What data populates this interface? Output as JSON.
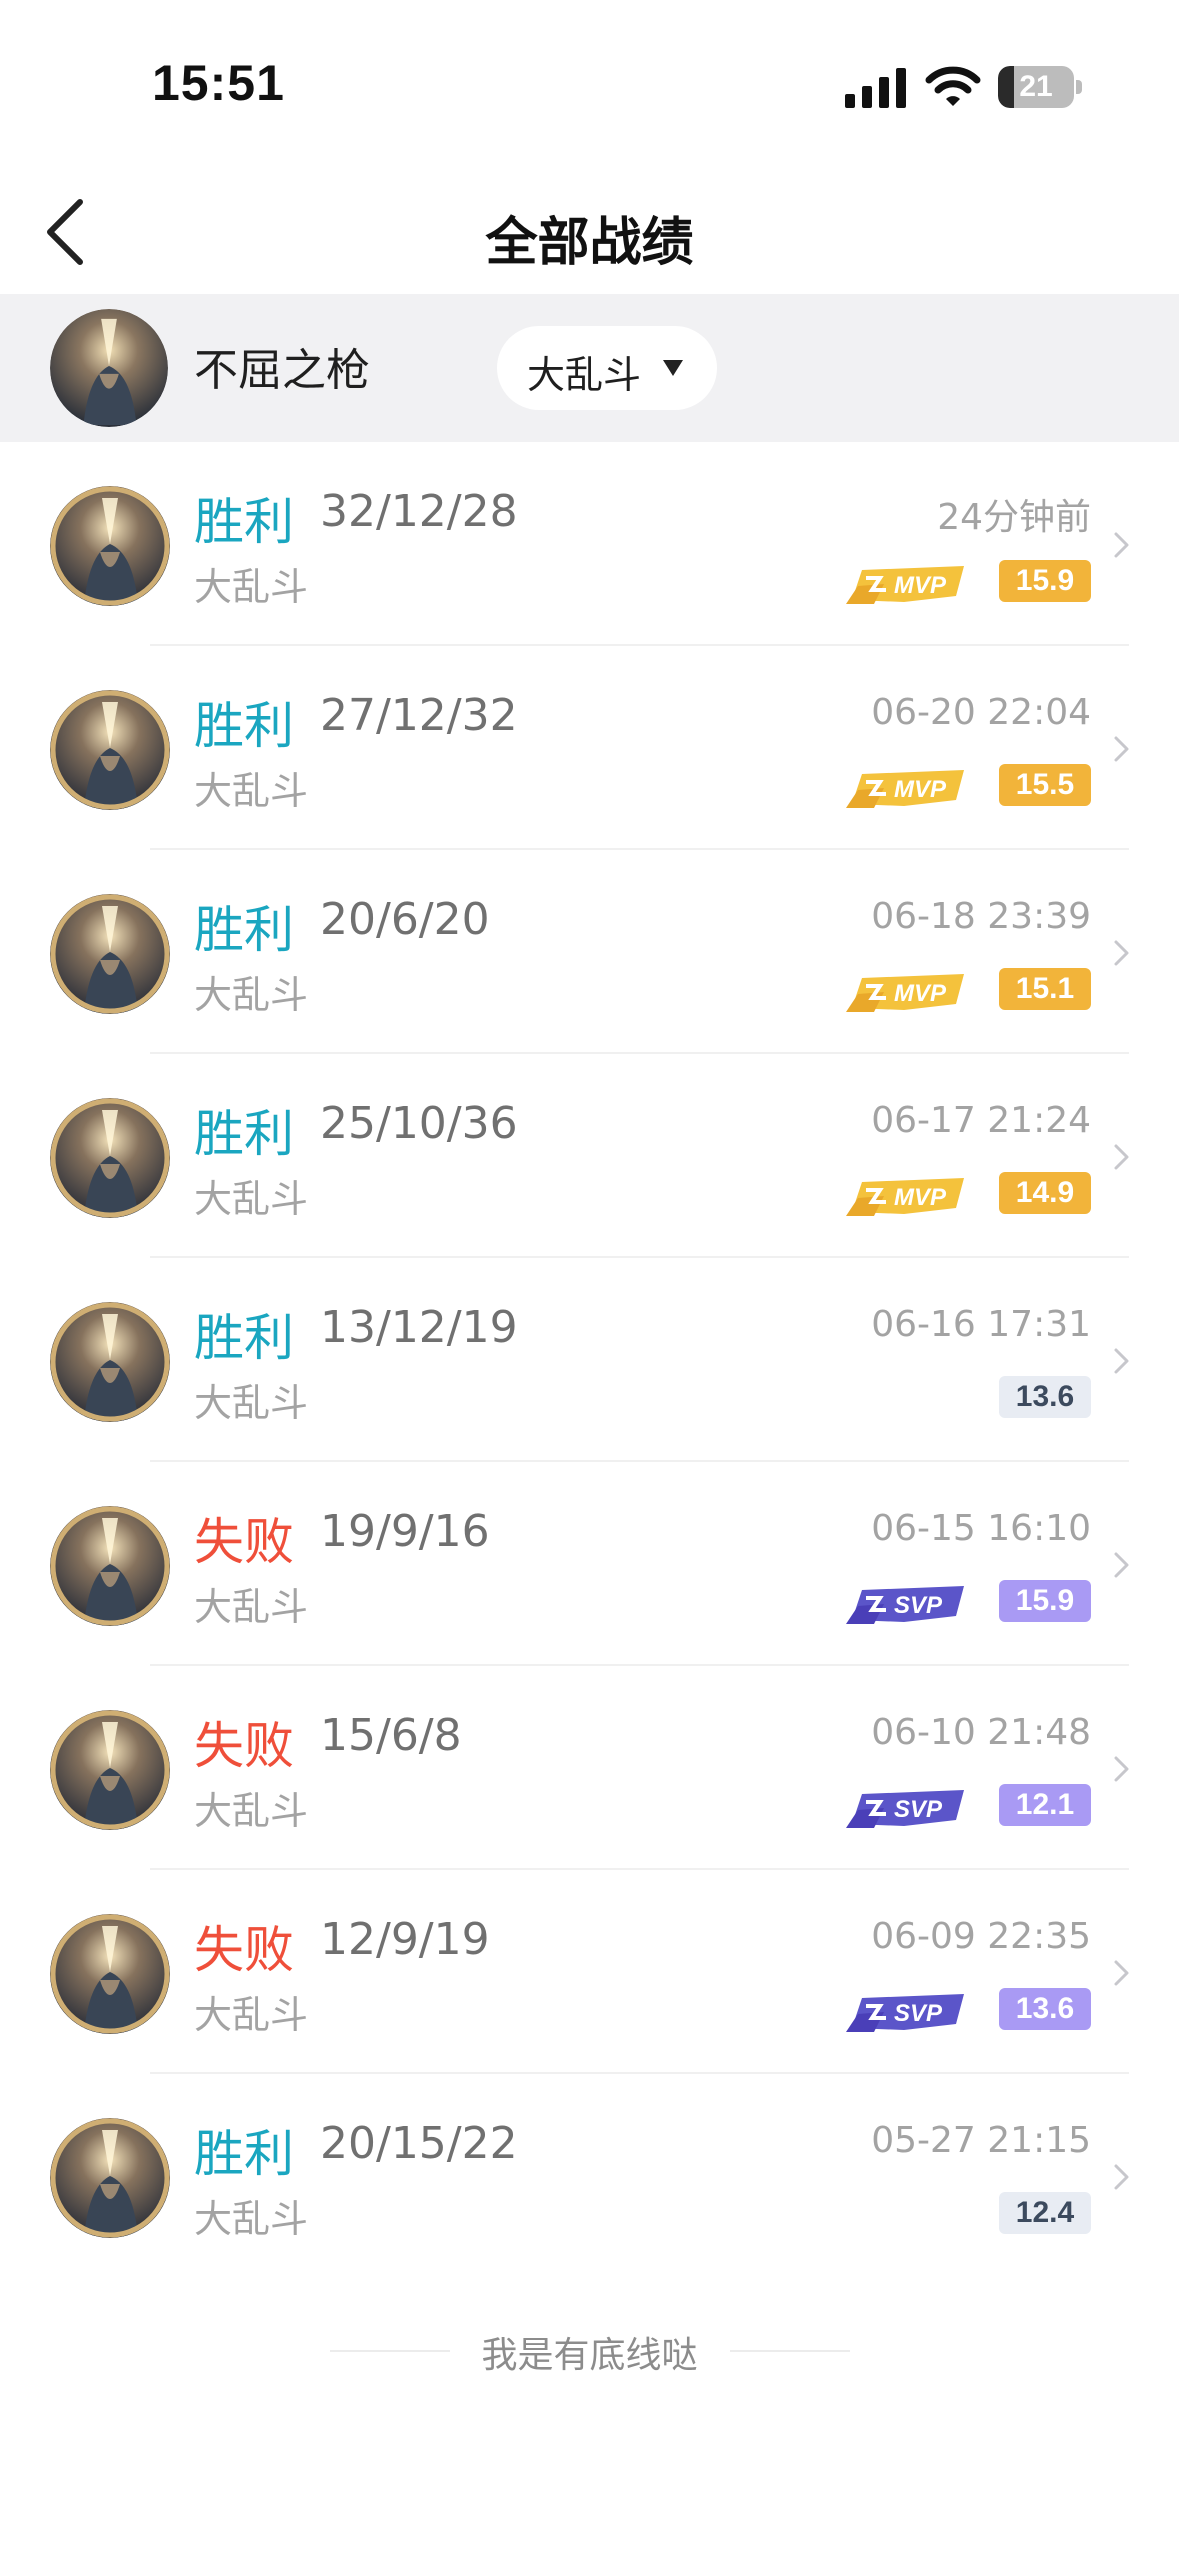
{
  "status_bar": {
    "time": "15:51",
    "battery_level": "21",
    "battery_fraction": 0.21
  },
  "nav": {
    "title": "全部战绩",
    "back_icon": "chevron-left-icon"
  },
  "filter": {
    "player_name": "不屈之枪",
    "mode_selected": "大乱斗"
  },
  "matches": [
    {
      "result": "胜利",
      "outcome": "win",
      "kda": "32/12/28",
      "mode": "大乱斗",
      "time": "24分钟前",
      "badge": "MVP",
      "score": "15.9"
    },
    {
      "result": "胜利",
      "outcome": "win",
      "kda": "27/12/32",
      "mode": "大乱斗",
      "time": "06-20 22:04",
      "badge": "MVP",
      "score": "15.5"
    },
    {
      "result": "胜利",
      "outcome": "win",
      "kda": "20/6/20",
      "mode": "大乱斗",
      "time": "06-18 23:39",
      "badge": "MVP",
      "score": "15.1"
    },
    {
      "result": "胜利",
      "outcome": "win",
      "kda": "25/10/36",
      "mode": "大乱斗",
      "time": "06-17 21:24",
      "badge": "MVP",
      "score": "14.9"
    },
    {
      "result": "胜利",
      "outcome": "win",
      "kda": "13/12/19",
      "mode": "大乱斗",
      "time": "06-16 17:31",
      "badge": "",
      "score": "13.6"
    },
    {
      "result": "失败",
      "outcome": "lose",
      "kda": "19/9/16",
      "mode": "大乱斗",
      "time": "06-15 16:10",
      "badge": "SVP",
      "score": "15.9"
    },
    {
      "result": "失败",
      "outcome": "lose",
      "kda": "15/6/8",
      "mode": "大乱斗",
      "time": "06-10 21:48",
      "badge": "SVP",
      "score": "12.1"
    },
    {
      "result": "失败",
      "outcome": "lose",
      "kda": "12/9/19",
      "mode": "大乱斗",
      "time": "06-09 22:35",
      "badge": "SVP",
      "score": "13.6"
    },
    {
      "result": "胜利",
      "outcome": "win",
      "kda": "20/15/22",
      "mode": "大乱斗",
      "time": "05-27 21:15",
      "badge": "",
      "score": "12.4"
    }
  ],
  "footer": {
    "text": "我是有底线哒"
  },
  "colors": {
    "win": "#1aa6c0",
    "lose": "#ef4f3a",
    "mvp": "#f2b43a",
    "svp": "#a99af4",
    "plain_score_bg": "#e8ecf3"
  }
}
